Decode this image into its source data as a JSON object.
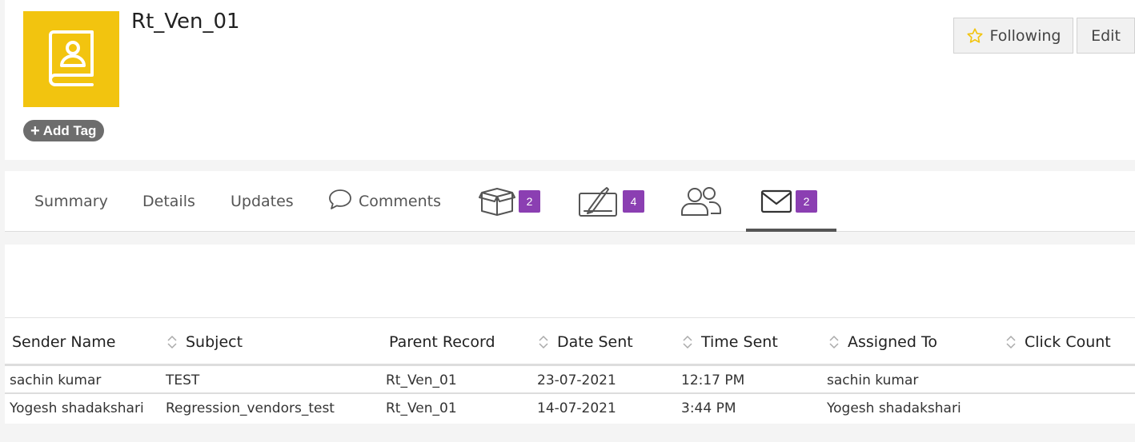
{
  "record": {
    "title": "Rt_Ven_01",
    "add_tag_label": "Add Tag"
  },
  "actions": {
    "following_label": "Following",
    "edit_label": "Edit"
  },
  "tabs": [
    {
      "label": "Summary"
    },
    {
      "label": "Details"
    },
    {
      "label": "Updates"
    },
    {
      "label": "Comments"
    },
    {
      "icon": "box-icon",
      "badge": "2"
    },
    {
      "icon": "contract-icon",
      "badge": "4"
    },
    {
      "icon": "users-icon"
    },
    {
      "icon": "envelope-icon",
      "badge": "2",
      "active": true
    }
  ],
  "table": {
    "columns": [
      "Sender Name",
      "Subject",
      "Parent Record",
      "Date Sent",
      "Time Sent",
      "Assigned To",
      "Click Count"
    ],
    "rows": [
      [
        "sachin kumar",
        "TEST",
        "Rt_Ven_01",
        "23-07-2021",
        "12:17 PM",
        "sachin kumar",
        ""
      ],
      [
        "Yogesh shadakshari",
        "Regression_vendors_test",
        "Rt_Ven_01",
        "14-07-2021",
        "3:44 PM",
        "Yogesh shadakshari",
        ""
      ]
    ]
  },
  "colors": {
    "avatar_bg": "#f2c40f",
    "badge_bg": "#8b3fb2",
    "star": "#f2c40f"
  }
}
